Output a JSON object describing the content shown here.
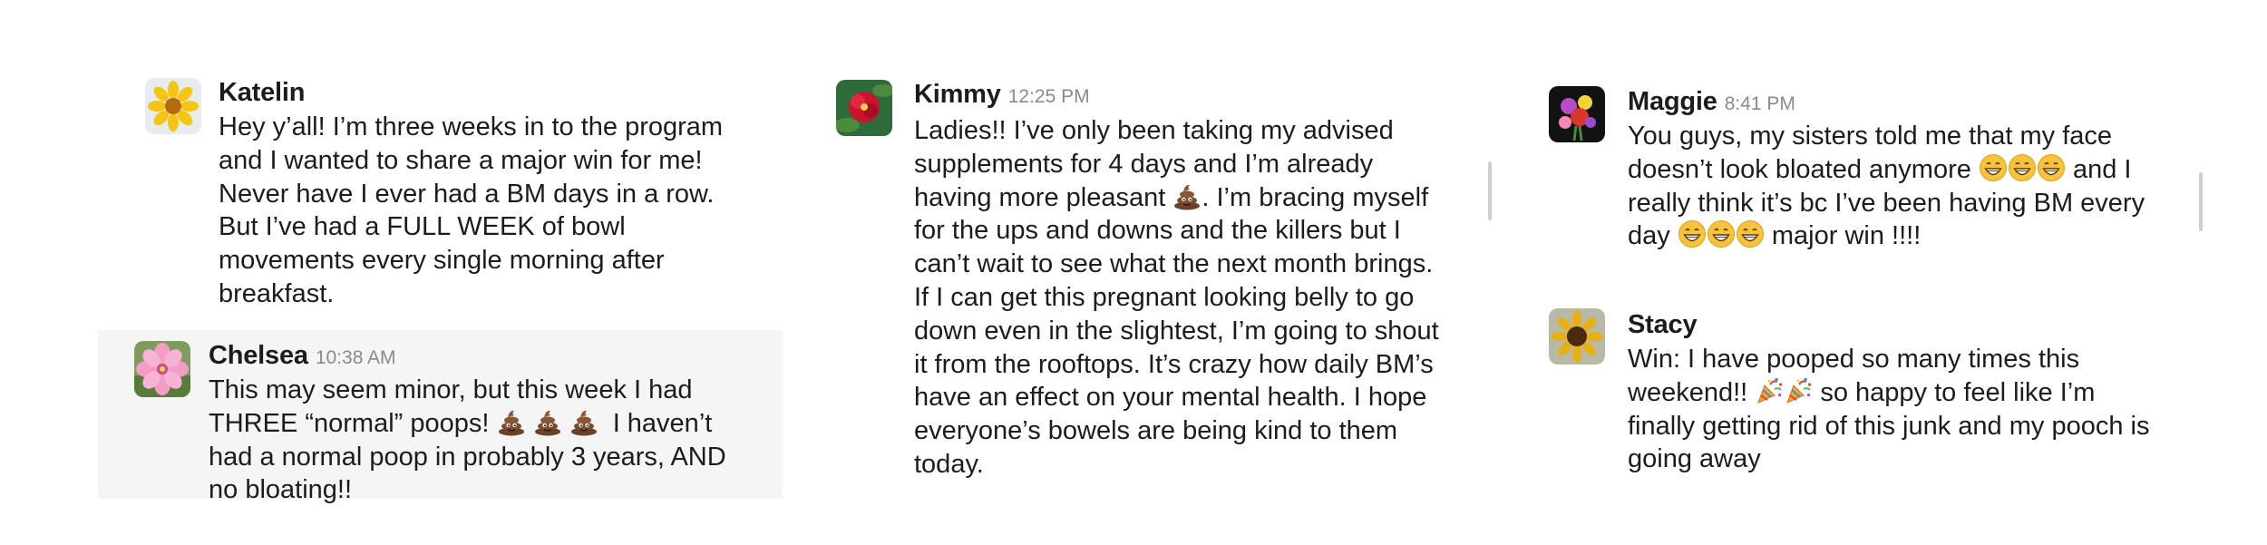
{
  "messages": {
    "katelin": {
      "name": "Katelin",
      "lines": [
        "Hey y’all! I’m three weeks in to the program",
        "and I wanted to share a major win for me!",
        "Never have I ever had a BM days in a row.",
        "But I’ve had a FULL WEEK of bowl",
        "movements every single morning after",
        "breakfast."
      ]
    },
    "chelsea": {
      "name": "Chelsea",
      "time": "10:38 AM",
      "lines": {
        "l1": "This may seem minor, but this week I had",
        "l2_a": "THREE “normal” poops!",
        "l2_b": "I haven’t",
        "l3": "had a normal poop in probably 3 years, AND",
        "l4": "no bloating!!"
      }
    },
    "kimmy": {
      "name": "Kimmy",
      "time": "12:25 PM",
      "lines": {
        "l1": "Ladies!! I’ve only been taking my advised",
        "l2": "supplements for 4 days and I’m already",
        "l3_a": "having more pleasant",
        "l3_b": ". I’m bracing myself",
        "l4": "for the ups and downs and the killers but I",
        "l5": "can’t wait to see what the next month brings.",
        "l6": "If I can get this pregnant looking belly to go",
        "l7": "down even in the slightest, I’m going to shout",
        "l8": "it from the rooftops. It’s crazy how daily BM’s",
        "l9": "have an effect on your mental health. I hope",
        "l10": "everyone’s bowels are being kind to them",
        "l11": "today."
      }
    },
    "maggie": {
      "name": "Maggie",
      "time": "8:41 PM",
      "lines": {
        "l1": "You guys, my sisters told me that my face",
        "l2_a": "doesn’t look bloated anymore",
        "l2_b": "and I",
        "l3": "really think it’s bc I’ve been having BM every",
        "l4_a": "day",
        "l4_b": "major win !!!!"
      }
    },
    "stacy": {
      "name": "Stacy",
      "lines": {
        "l1": "Win: I have pooped so many times this",
        "l2_a": "weekend!!",
        "l2_b": "so happy to feel like I’m",
        "l3": "finally getting rid of this junk and my pooch is",
        "l4": "going away"
      }
    }
  },
  "icons": {
    "poop": "pile-of-poo-emoji",
    "grin": "grinning-face-emoji",
    "party": "party-popper-emoji"
  },
  "colors": {
    "text": "#1d1c1d",
    "timestamp": "#8a8a8a",
    "highlight_bg": "#f5f5f5",
    "scrollbar": "#cfcfcf"
  }
}
